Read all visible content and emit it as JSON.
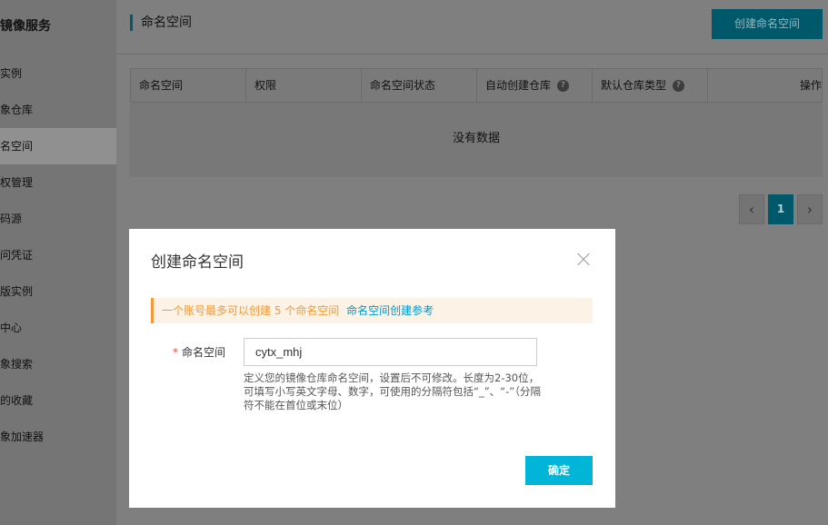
{
  "sidebar": {
    "title": "镜像服务",
    "items": [
      {
        "label": "实例",
        "active": false
      },
      {
        "label": "象仓库",
        "active": false
      },
      {
        "label": "名空间",
        "active": true
      },
      {
        "label": "权管理",
        "active": false
      },
      {
        "label": "码源",
        "active": false
      },
      {
        "label": "问凭证",
        "active": false
      },
      {
        "label": "版实例",
        "active": false
      },
      {
        "label": "中心",
        "active": false
      },
      {
        "label": "象搜索",
        "active": false
      },
      {
        "label": "的收藏",
        "active": false
      },
      {
        "label": "象加速器",
        "active": false
      }
    ]
  },
  "header": {
    "title": "命名空间",
    "create_button": "创建命名空间"
  },
  "table": {
    "columns": [
      "命名空间",
      "权限",
      "命名空间状态",
      "自动创建仓库",
      "默认仓库类型",
      "操作"
    ],
    "help_icon_text": "?",
    "empty_text": "没有数据"
  },
  "pagination": {
    "prev": "‹",
    "current": "1",
    "next": "›"
  },
  "dialog": {
    "title": "创建命名空间",
    "notice_text": "一个账号最多可以创建 5 个命名空间",
    "notice_link": "命名空间创建参考",
    "field_required_mark": "*",
    "field_label": "命名空间",
    "field_value": "cytx_mhj",
    "hint": "定义您的镜像仓库命名空间，设置后不可修改。长度为2-30位，可填写小写英文字母、数字，可使用的分隔符包括“_”、“-”（分隔符不能在首位或末位）",
    "confirm_button": "确定"
  },
  "colors": {
    "accent": "#00b5d8",
    "notice": "#f29a38",
    "link": "#0099cc",
    "required": "#e64e3d"
  }
}
